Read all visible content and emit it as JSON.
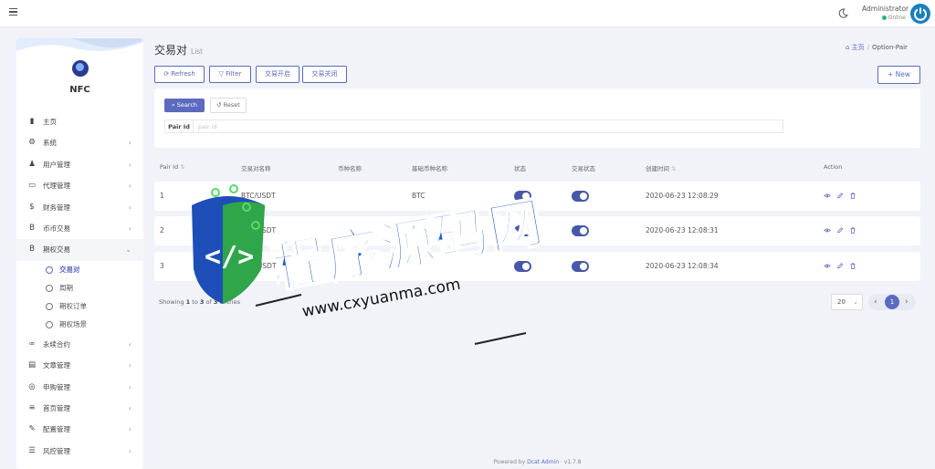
{
  "header": {
    "user_name": "Administrator",
    "user_status": "Online"
  },
  "sidebar": {
    "brand": "NFC",
    "items": [
      {
        "label": "主页",
        "icon": "bar-chart-icon",
        "glyph": "▮",
        "has_children": false
      },
      {
        "label": "系统",
        "icon": "gear-icon",
        "glyph": "⚙",
        "has_children": true
      },
      {
        "label": "用户管理",
        "icon": "users-icon",
        "glyph": "♟",
        "has_children": true
      },
      {
        "label": "代理管理",
        "icon": "id-card-icon",
        "glyph": "▭",
        "has_children": true
      },
      {
        "label": "财务管理",
        "icon": "dollar-icon",
        "glyph": "$",
        "has_children": true
      },
      {
        "label": "币币交易",
        "icon": "bitcoin-icon",
        "glyph": "B",
        "has_children": true
      },
      {
        "label": "期权交易",
        "icon": "bitcoin-icon",
        "glyph": "B",
        "has_children": true,
        "open": true
      }
    ],
    "sub_items": [
      {
        "label": "交易对",
        "active": true
      },
      {
        "label": "周期",
        "active": false
      },
      {
        "label": "期权订单",
        "active": false
      },
      {
        "label": "期权场景",
        "active": false
      }
    ],
    "items_after": [
      {
        "label": "永续合约",
        "icon": "link-icon",
        "glyph": "∞",
        "has_children": true
      },
      {
        "label": "文章管理",
        "icon": "newspaper-icon",
        "glyph": "▤",
        "has_children": true
      },
      {
        "label": "申购管理",
        "icon": "life-ring-icon",
        "glyph": "◎",
        "has_children": true
      },
      {
        "label": "首页管理",
        "icon": "list-icon",
        "glyph": "≡",
        "has_children": true
      },
      {
        "label": "配置管理",
        "icon": "wrench-icon",
        "glyph": "✎",
        "has_children": true
      },
      {
        "label": "风控管理",
        "icon": "indent-icon",
        "glyph": "☰",
        "has_children": true
      }
    ]
  },
  "page": {
    "title": "交易对",
    "subtitle": "List",
    "breadcrumb": [
      "主页",
      "Option-Pair"
    ]
  },
  "toolbar": {
    "refresh": "Refresh",
    "filter": "Filter",
    "open_trade": "交易开启",
    "close_trade": "交易关闭",
    "new": "New"
  },
  "filter": {
    "search": "Search",
    "reset": "Reset",
    "pair_id_label": "Pair Id",
    "pair_id_placeholder": "pair id",
    "pair_id_value": ""
  },
  "table": {
    "columns": [
      "Pair Id",
      "交易对名称",
      "币种名称",
      "基础币种名称",
      "状态",
      "交易状态",
      "创建时间",
      "Action"
    ],
    "rows": [
      {
        "id": "1",
        "pair_name": "BTC/USDT",
        "coin_name": "",
        "base_coin": "BTC",
        "status": true,
        "trade_status": true,
        "created_at": "2020-06-23 12:08:29"
      },
      {
        "id": "2",
        "pair_name": "ETH/USDT",
        "coin_name": "",
        "base_coin": "ETH",
        "status": true,
        "trade_status": true,
        "created_at": "2020-06-23 12:08:31"
      },
      {
        "id": "3",
        "pair_name": "EOS/USDT",
        "coin_name": "",
        "base_coin": "",
        "status": true,
        "trade_status": true,
        "created_at": "2020-06-23 12:08:34"
      }
    ]
  },
  "pagination": {
    "showing_prefix": "Showing",
    "from": "1",
    "to_word": "to",
    "to": "3",
    "of_word": "of",
    "total": "3",
    "entries_word": "entries",
    "per_page": "20",
    "current_page": "1"
  },
  "footer": {
    "prefix": "Powered by",
    "brand": "Dcat Admin",
    "version": "· v1.7.8"
  },
  "watermark": {
    "title": "程序源码网",
    "url": "www.cxyuanma.com"
  },
  "colors": {
    "primary": "#5c6bc0",
    "toggle_on": "#4758a9",
    "background": "#f1f3f9",
    "online": "#21b978"
  }
}
